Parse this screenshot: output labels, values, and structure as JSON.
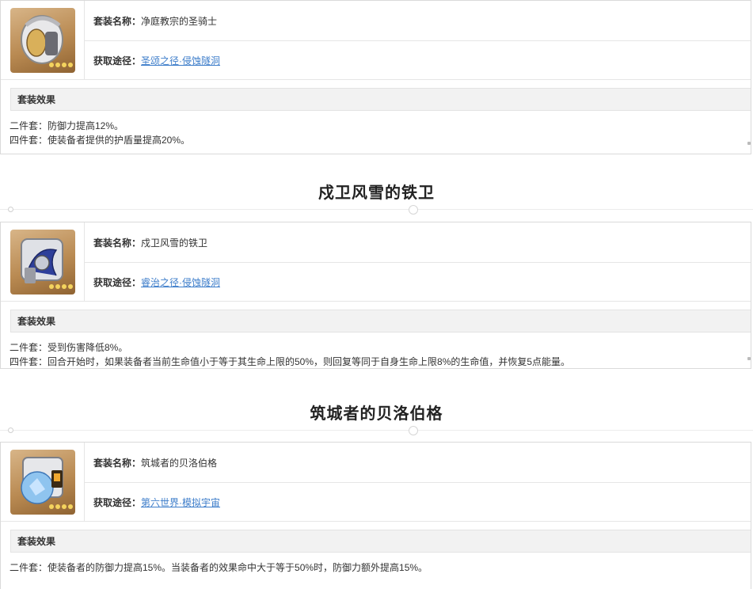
{
  "labels": {
    "set_name": "套装名称：",
    "source": "获取途径：",
    "effect_header": "套装效果"
  },
  "sets": [
    {
      "name": "净庭教宗的圣骑士",
      "source": "圣颂之径·侵蚀隧洞",
      "effects": [
        "二件套：防御力提高12%。",
        "四件套：使装备者提供的护盾量提高20%。"
      ],
      "icon": "paladin-helmet-icon"
    },
    {
      "title": "戍卫风雪的铁卫",
      "name": "戍卫风雪的铁卫",
      "source": "睿治之径·侵蚀隧洞",
      "effects": [
        "二件套：受到伤害降低8%。",
        "四件套：回合开始时，如果装备者当前生命值小于等于其生命上限的50%，则回复等同于自身生命上限8%的生命值，并恢复5点能量。"
      ],
      "icon": "guard-armor-icon"
    },
    {
      "title": "筑城者的贝洛伯格",
      "name": "筑城者的贝洛伯格",
      "source": "第六世界·模拟宇宙",
      "effects": [
        "二件套：使装备者的防御力提高15%。当装备者的效果命中大于等于50%时，防御力额外提高15%。"
      ],
      "icon": "belobog-sphere-icon"
    }
  ],
  "colors": {
    "link": "#3d7dca",
    "header_bg": "#f2f2f2",
    "border": "#dadada"
  }
}
